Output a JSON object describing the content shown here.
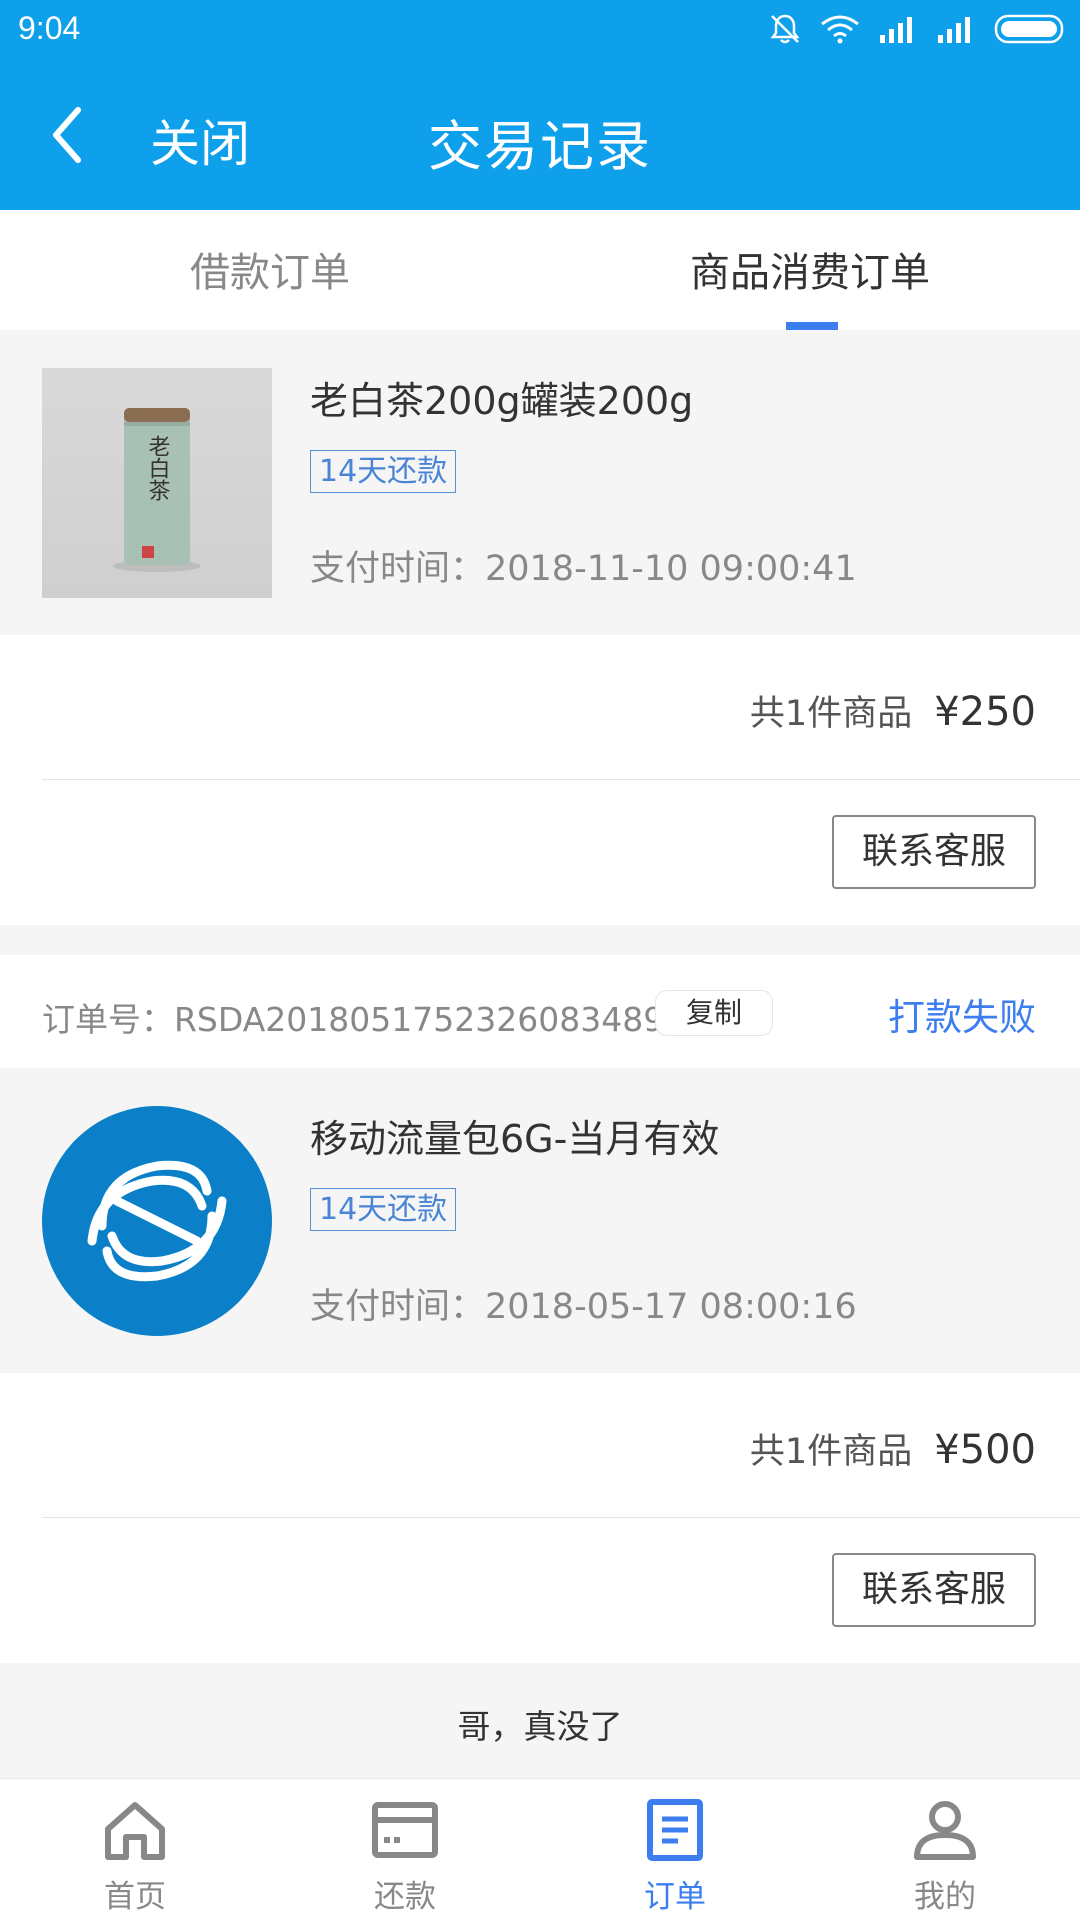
{
  "status_bar": {
    "time": "9:04"
  },
  "header": {
    "back_icon": "chevron-left-icon",
    "close_label": "关闭",
    "title": "交易记录"
  },
  "tabs": [
    {
      "label": "借款订单",
      "active": false
    },
    {
      "label": "商品消费订单",
      "active": true
    }
  ],
  "orders": [
    {
      "product_name": "老白茶200g罐装200g",
      "tag": "14天还款",
      "pay_time": "支付时间：2018-11-10 09:00:41",
      "count_text": "共1件商品",
      "price": "¥250",
      "service_label": "联系客服",
      "image_text": "老白茶"
    },
    {
      "order_no": "订单号：RSDA2018051752326083489",
      "copy_label": "复制",
      "status": "打款失败",
      "product_name": "移动流量包6G-当月有效",
      "tag": "14天还款",
      "pay_time": "支付时间：2018-05-17 08:00:16",
      "count_text": "共1件商品",
      "price": "¥500",
      "service_label": "联系客服"
    }
  ],
  "end_text": "哥，真没了",
  "bottom_nav": [
    {
      "label": "首页",
      "icon": "home-icon",
      "active": false
    },
    {
      "label": "还款",
      "icon": "card-icon",
      "active": false
    },
    {
      "label": "订单",
      "icon": "order-icon",
      "active": true
    },
    {
      "label": "我的",
      "icon": "profile-icon",
      "active": false
    }
  ],
  "colors": {
    "primary": "#0ea0ea",
    "accent": "#3c7ef0",
    "background": "#f5f5f5"
  }
}
